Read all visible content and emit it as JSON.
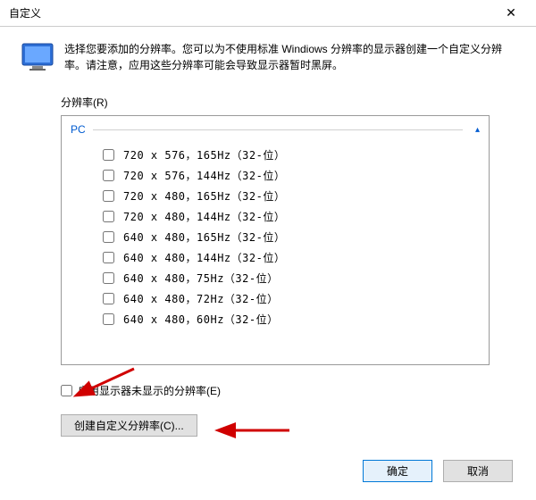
{
  "window": {
    "title": "自定义",
    "close_icon": "✕"
  },
  "intro": {
    "text": "选择您要添加的分辨率。您可以为不使用标准 Windiows 分辨率的显示器创建一个自定义分辨率。请注意，应用这些分辨率可能会导致显示器暂时黑屏。"
  },
  "section": {
    "label": "分辨率(R)"
  },
  "group": {
    "name": "PC",
    "caret": "▴"
  },
  "resolutions": [
    {
      "label": "720 x 576，165Hz（32-位）"
    },
    {
      "label": "720 x 576，144Hz（32-位）"
    },
    {
      "label": "720 x 480，165Hz（32-位）"
    },
    {
      "label": "720 x 480，144Hz（32-位）"
    },
    {
      "label": "640 x 480，165Hz（32-位）"
    },
    {
      "label": "640 x 480，144Hz（32-位）"
    },
    {
      "label": "640 x 480，75Hz（32-位）"
    },
    {
      "label": "640 x 480，72Hz（32-位）"
    },
    {
      "label": "640 x 480，60Hz（32-位）"
    }
  ],
  "enable_hidden": {
    "label": "启用显示器未显示的分辨率(E)"
  },
  "create_custom": {
    "label": "创建自定义分辨率(C)..."
  },
  "buttons": {
    "ok": "确定",
    "cancel": "取消"
  }
}
